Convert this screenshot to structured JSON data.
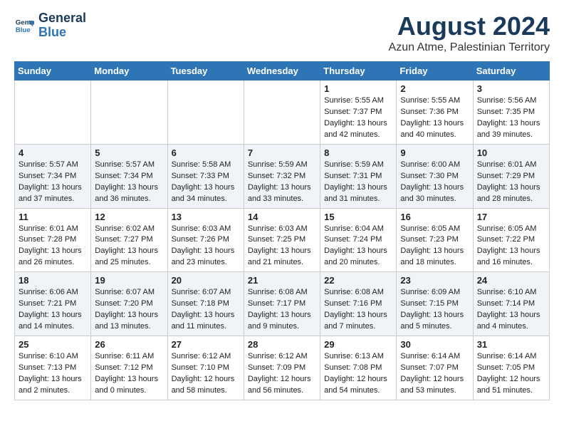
{
  "header": {
    "logo_line1": "General",
    "logo_line2": "Blue",
    "month_title": "August 2024",
    "location": "Azun Atme, Palestinian Territory"
  },
  "weekdays": [
    "Sunday",
    "Monday",
    "Tuesday",
    "Wednesday",
    "Thursday",
    "Friday",
    "Saturday"
  ],
  "weeks": [
    [
      {
        "day": "",
        "info": ""
      },
      {
        "day": "",
        "info": ""
      },
      {
        "day": "",
        "info": ""
      },
      {
        "day": "",
        "info": ""
      },
      {
        "day": "1",
        "info": "Sunrise: 5:55 AM\nSunset: 7:37 PM\nDaylight: 13 hours\nand 42 minutes."
      },
      {
        "day": "2",
        "info": "Sunrise: 5:55 AM\nSunset: 7:36 PM\nDaylight: 13 hours\nand 40 minutes."
      },
      {
        "day": "3",
        "info": "Sunrise: 5:56 AM\nSunset: 7:35 PM\nDaylight: 13 hours\nand 39 minutes."
      }
    ],
    [
      {
        "day": "4",
        "info": "Sunrise: 5:57 AM\nSunset: 7:34 PM\nDaylight: 13 hours\nand 37 minutes."
      },
      {
        "day": "5",
        "info": "Sunrise: 5:57 AM\nSunset: 7:34 PM\nDaylight: 13 hours\nand 36 minutes."
      },
      {
        "day": "6",
        "info": "Sunrise: 5:58 AM\nSunset: 7:33 PM\nDaylight: 13 hours\nand 34 minutes."
      },
      {
        "day": "7",
        "info": "Sunrise: 5:59 AM\nSunset: 7:32 PM\nDaylight: 13 hours\nand 33 minutes."
      },
      {
        "day": "8",
        "info": "Sunrise: 5:59 AM\nSunset: 7:31 PM\nDaylight: 13 hours\nand 31 minutes."
      },
      {
        "day": "9",
        "info": "Sunrise: 6:00 AM\nSunset: 7:30 PM\nDaylight: 13 hours\nand 30 minutes."
      },
      {
        "day": "10",
        "info": "Sunrise: 6:01 AM\nSunset: 7:29 PM\nDaylight: 13 hours\nand 28 minutes."
      }
    ],
    [
      {
        "day": "11",
        "info": "Sunrise: 6:01 AM\nSunset: 7:28 PM\nDaylight: 13 hours\nand 26 minutes."
      },
      {
        "day": "12",
        "info": "Sunrise: 6:02 AM\nSunset: 7:27 PM\nDaylight: 13 hours\nand 25 minutes."
      },
      {
        "day": "13",
        "info": "Sunrise: 6:03 AM\nSunset: 7:26 PM\nDaylight: 13 hours\nand 23 minutes."
      },
      {
        "day": "14",
        "info": "Sunrise: 6:03 AM\nSunset: 7:25 PM\nDaylight: 13 hours\nand 21 minutes."
      },
      {
        "day": "15",
        "info": "Sunrise: 6:04 AM\nSunset: 7:24 PM\nDaylight: 13 hours\nand 20 minutes."
      },
      {
        "day": "16",
        "info": "Sunrise: 6:05 AM\nSunset: 7:23 PM\nDaylight: 13 hours\nand 18 minutes."
      },
      {
        "day": "17",
        "info": "Sunrise: 6:05 AM\nSunset: 7:22 PM\nDaylight: 13 hours\nand 16 minutes."
      }
    ],
    [
      {
        "day": "18",
        "info": "Sunrise: 6:06 AM\nSunset: 7:21 PM\nDaylight: 13 hours\nand 14 minutes."
      },
      {
        "day": "19",
        "info": "Sunrise: 6:07 AM\nSunset: 7:20 PM\nDaylight: 13 hours\nand 13 minutes."
      },
      {
        "day": "20",
        "info": "Sunrise: 6:07 AM\nSunset: 7:18 PM\nDaylight: 13 hours\nand 11 minutes."
      },
      {
        "day": "21",
        "info": "Sunrise: 6:08 AM\nSunset: 7:17 PM\nDaylight: 13 hours\nand 9 minutes."
      },
      {
        "day": "22",
        "info": "Sunrise: 6:08 AM\nSunset: 7:16 PM\nDaylight: 13 hours\nand 7 minutes."
      },
      {
        "day": "23",
        "info": "Sunrise: 6:09 AM\nSunset: 7:15 PM\nDaylight: 13 hours\nand 5 minutes."
      },
      {
        "day": "24",
        "info": "Sunrise: 6:10 AM\nSunset: 7:14 PM\nDaylight: 13 hours\nand 4 minutes."
      }
    ],
    [
      {
        "day": "25",
        "info": "Sunrise: 6:10 AM\nSunset: 7:13 PM\nDaylight: 13 hours\nand 2 minutes."
      },
      {
        "day": "26",
        "info": "Sunrise: 6:11 AM\nSunset: 7:12 PM\nDaylight: 13 hours\nand 0 minutes."
      },
      {
        "day": "27",
        "info": "Sunrise: 6:12 AM\nSunset: 7:10 PM\nDaylight: 12 hours\nand 58 minutes."
      },
      {
        "day": "28",
        "info": "Sunrise: 6:12 AM\nSunset: 7:09 PM\nDaylight: 12 hours\nand 56 minutes."
      },
      {
        "day": "29",
        "info": "Sunrise: 6:13 AM\nSunset: 7:08 PM\nDaylight: 12 hours\nand 54 minutes."
      },
      {
        "day": "30",
        "info": "Sunrise: 6:14 AM\nSunset: 7:07 PM\nDaylight: 12 hours\nand 53 minutes."
      },
      {
        "day": "31",
        "info": "Sunrise: 6:14 AM\nSunset: 7:05 PM\nDaylight: 12 hours\nand 51 minutes."
      }
    ]
  ]
}
